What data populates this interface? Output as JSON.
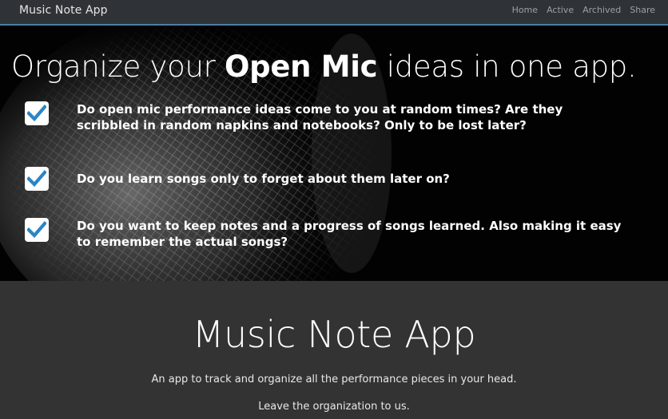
{
  "navbar": {
    "brand": "Music Note App",
    "links": [
      "Home",
      "Active",
      "Archived",
      "Share"
    ]
  },
  "hero": {
    "title_prefix": "Organize your ",
    "title_bold": "Open Mic",
    "title_suffix": " ideas in one app.",
    "features": [
      "Do open mic performance ideas come to you at random times? Are they scribbled in random napkins and notebooks? Only to be lost later?",
      "Do you learn songs only to forget about them later on?",
      "Do you want to keep notes and a progress of songs learned. Also making it easy to remember the actual songs?"
    ]
  },
  "about": {
    "title": "Music Note App",
    "line1": "An app to track and organize all the performance pieces in your head.",
    "line2": "Leave the organization to us."
  },
  "colors": {
    "accent": "#4a7fa7",
    "check": "#2a86c5",
    "navbar": "#2f3337",
    "section": "#333333"
  },
  "icons": [
    "checkbox-checked-icon"
  ]
}
